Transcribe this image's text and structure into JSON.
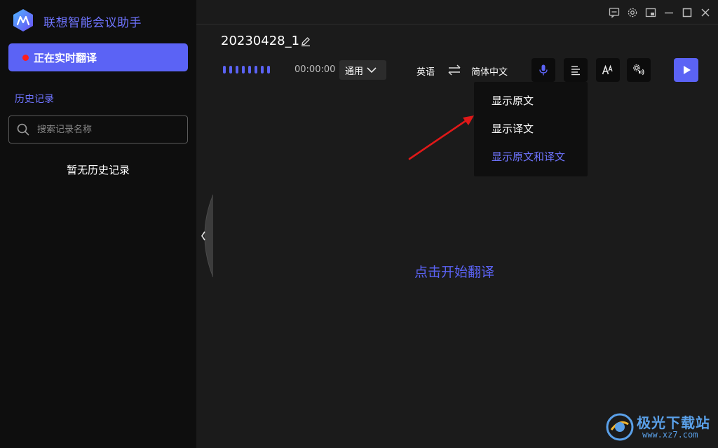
{
  "app": {
    "title": "联想智能会议助手"
  },
  "sidebar": {
    "live_button_label": "正在实时翻译",
    "history_title": "历史记录",
    "search_placeholder": "搜索记录名称",
    "empty_text": "暂无历史记录"
  },
  "header": {
    "session_name": "20230428_1",
    "timer": "00:00:00",
    "mode": "通用",
    "source_language": "英语",
    "target_language": "简体中文"
  },
  "display_menu": {
    "items": [
      {
        "label": "显示原文",
        "selected": false
      },
      {
        "label": "显示译文",
        "selected": false
      },
      {
        "label": "显示原文和译文",
        "selected": true
      }
    ]
  },
  "main": {
    "start_hint": "点击开始翻译"
  },
  "watermark": {
    "text": "极光下载站",
    "url": "www.xz7.com"
  },
  "colors": {
    "accent": "#5b63f5",
    "sidebar_bg": "#0e0e0e",
    "main_bg": "#1b1b1b",
    "recording_dot": "#ff1e1e"
  },
  "icons": [
    "app-logo-icon",
    "feedback-icon",
    "gear-icon",
    "pip-icon",
    "minimize-icon",
    "maximize-icon",
    "close-icon",
    "edit-icon",
    "chevron-down-icon",
    "swap-icon",
    "microphone-icon",
    "text-layout-icon",
    "font-size-icon",
    "speaker-settings-icon",
    "play-icon",
    "chevron-left-icon",
    "search-icon"
  ]
}
